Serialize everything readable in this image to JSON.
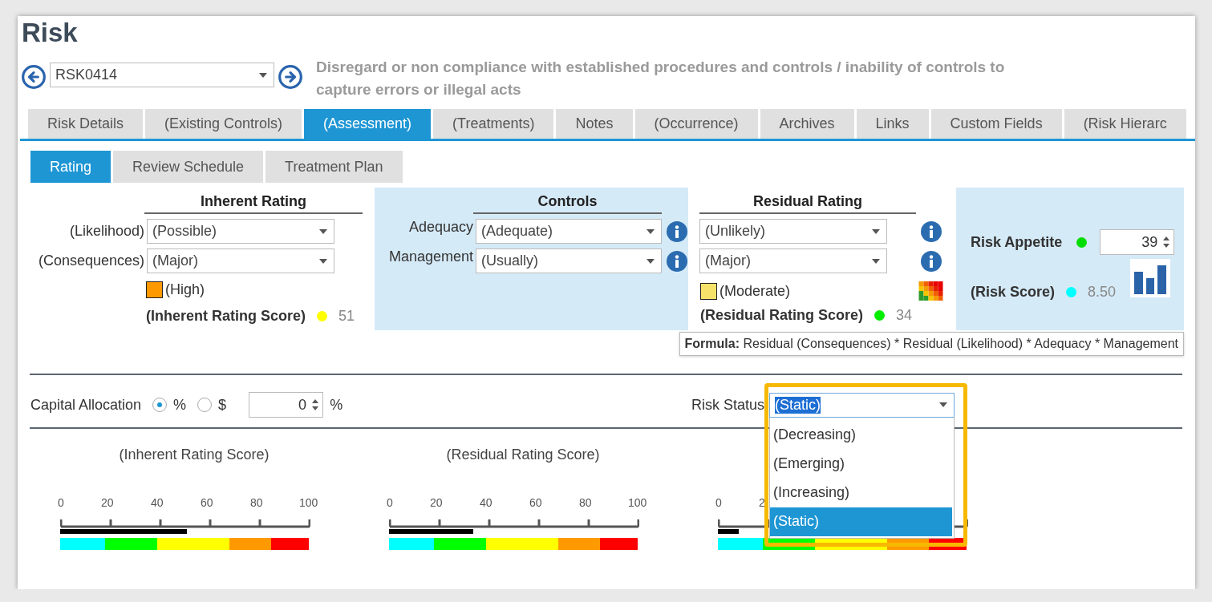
{
  "page_title": "Risk",
  "record": {
    "value": "RSK0414"
  },
  "description": "Disregard or non compliance with established procedures and controls / inability of controls to capture errors or illegal acts",
  "tabs": [
    {
      "label": "Risk Details",
      "selected": false
    },
    {
      "label": "(Existing Controls)",
      "selected": false
    },
    {
      "label": "(Assessment)",
      "selected": true
    },
    {
      "label": "(Treatments)",
      "selected": false
    },
    {
      "label": "Notes",
      "selected": false
    },
    {
      "label": "(Occurrence)",
      "selected": false
    },
    {
      "label": "Archives",
      "selected": false
    },
    {
      "label": "Links",
      "selected": false
    },
    {
      "label": "Custom Fields",
      "selected": false
    },
    {
      "label": "(Risk Hierarc",
      "selected": false
    }
  ],
  "subtabs": [
    {
      "label": "Rating",
      "selected": true
    },
    {
      "label": "Review Schedule",
      "selected": false
    },
    {
      "label": "Treatment Plan",
      "selected": false
    }
  ],
  "inherent_rating": {
    "title": "Inherent Rating",
    "fields": [
      {
        "label": "(Likelihood)",
        "value": "(Possible)"
      },
      {
        "label": "(Consequences)",
        "value": "(Major)"
      }
    ],
    "rating": {
      "label": "(High)",
      "color": "#ff9900"
    },
    "score": {
      "label": "(Inherent Rating Score)",
      "color": "#ffff00",
      "value": "51"
    }
  },
  "controls": {
    "title": "Controls",
    "fields": [
      {
        "label": "Adequacy",
        "value": "(Adequate)"
      },
      {
        "label": "Management",
        "value": "(Usually)"
      }
    ]
  },
  "residual_rating": {
    "title": "Residual Rating",
    "fields": [
      {
        "value": "(Unlikely)"
      },
      {
        "value": "(Major)"
      }
    ],
    "rating": {
      "label": "(Moderate)",
      "color": "#f5e36a"
    },
    "score": {
      "label": "(Residual Rating Score)",
      "color": "#00ee00",
      "value": "34"
    }
  },
  "risk_appetite": {
    "label": "Risk Appetite",
    "color": "#00dd00",
    "value": "39"
  },
  "risk_score": {
    "label": "(Risk Score)",
    "color": "#00ffff",
    "value": "8.50"
  },
  "formula": "**Formula:** Residual (Consequences) * Residual (Likelihood) * Adequacy * Management",
  "capital_allocation": {
    "label": "Capital Allocation",
    "options": [
      {
        "label": "%",
        "selected": true
      },
      {
        "label": "$",
        "selected": false
      }
    ],
    "value": "0",
    "unit": "%"
  },
  "risk_status": {
    "label": "Risk Status",
    "value": "(Static)",
    "expanded": true,
    "options": [
      {
        "label": "(Decreasing)",
        "selected": false
      },
      {
        "label": "(Emerging)",
        "selected": false
      },
      {
        "label": "(Increasing)",
        "selected": false
      },
      {
        "label": "(Static)",
        "selected": true
      }
    ]
  },
  "gauges": [
    {
      "title": "(Inherent Rating Score)",
      "ticks": [
        "0",
        "20",
        "40",
        "60",
        "80",
        "100"
      ],
      "level": 0.51
    },
    {
      "title": "(Residual Rating Score)",
      "ticks": [
        "0",
        "20",
        "40",
        "60",
        "80",
        "100"
      ],
      "level": 0.34
    },
    {
      "ticks": [
        "0",
        "2"
      ],
      "level": 0.085
    }
  ]
}
